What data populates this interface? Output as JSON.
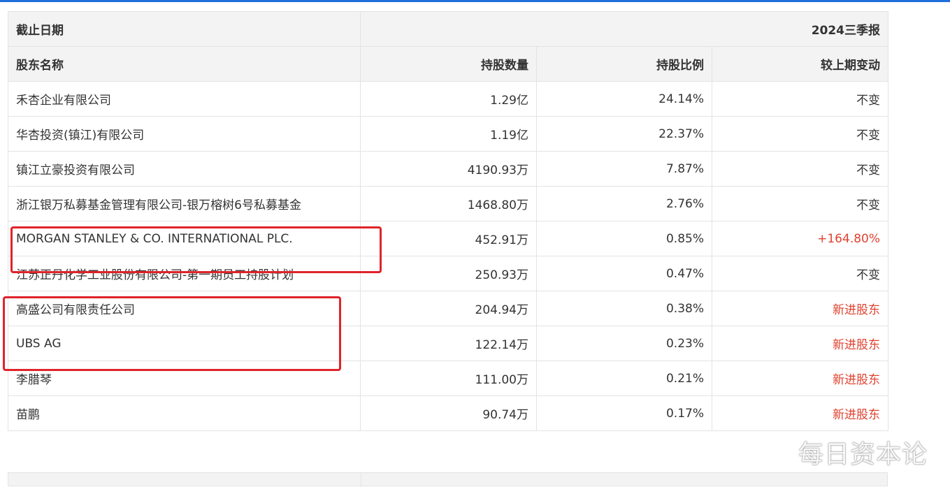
{
  "header": {
    "date_label": "截止日期",
    "period": "2024三季报"
  },
  "columns": {
    "name": "股东名称",
    "shares": "持股数量",
    "ratio": "持股比例",
    "change": "较上期变动"
  },
  "rows": [
    {
      "name": "禾杏企业有限公司",
      "shares": "1.29亿",
      "ratio": "24.14%",
      "change": "不变",
      "highlight": false
    },
    {
      "name": "华杏投资(镇江)有限公司",
      "shares": "1.19亿",
      "ratio": "22.37%",
      "change": "不变",
      "highlight": false
    },
    {
      "name": "镇江立豪投资有限公司",
      "shares": "4190.93万",
      "ratio": "7.87%",
      "change": "不变",
      "highlight": false
    },
    {
      "name": "浙江银万私募基金管理有限公司-银万榕树6号私募基金",
      "shares": "1468.80万",
      "ratio": "2.76%",
      "change": "不变",
      "highlight": false
    },
    {
      "name": "MORGAN STANLEY & CO. INTERNATIONAL PLC.",
      "shares": "452.91万",
      "ratio": "0.85%",
      "change": "+164.80%",
      "highlight": true
    },
    {
      "name": "江苏正丹化学工业股份有限公司-第一期员工持股计划",
      "shares": "250.93万",
      "ratio": "0.47%",
      "change": "不变",
      "highlight": false
    },
    {
      "name": "高盛公司有限责任公司",
      "shares": "204.94万",
      "ratio": "0.38%",
      "change": "新进股东",
      "highlight": true
    },
    {
      "name": "UBS AG",
      "shares": "122.14万",
      "ratio": "0.23%",
      "change": "新进股东",
      "highlight": true
    },
    {
      "name": "李腊琴",
      "shares": "111.00万",
      "ratio": "0.21%",
      "change": "新进股东",
      "highlight": false
    },
    {
      "name": "苗鹏",
      "shares": "90.74万",
      "ratio": "0.17%",
      "change": "新进股东",
      "highlight": false
    }
  ],
  "watermark": "每日资本论",
  "colors": {
    "accent_blue": "#1e6fd9",
    "change_red": "#e0412f",
    "highlight_box": "#e0232a",
    "header_bg": "#f3f3f3"
  }
}
